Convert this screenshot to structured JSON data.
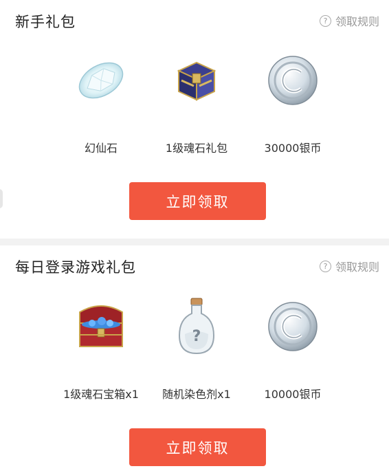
{
  "sections": [
    {
      "title": "新手礼包",
      "rules_label": "领取规则",
      "items": [
        {
          "label": "幻仙石",
          "icon": "crystal-stone-icon"
        },
        {
          "label": "1级魂石礼包",
          "icon": "soul-stone-pack-icon"
        },
        {
          "label": "30000银币",
          "icon": "silver-coin-icon"
        }
      ],
      "claim_label": "立即领取"
    },
    {
      "title": "每日登录游戏礼包",
      "rules_label": "领取规则",
      "items": [
        {
          "label": "1级魂石宝箱x1",
          "icon": "treasure-chest-icon"
        },
        {
          "label": "随机染色剂x1",
          "icon": "potion-bottle-icon"
        },
        {
          "label": "10000银币",
          "icon": "silver-coin-icon"
        }
      ],
      "claim_label": "立即领取"
    }
  ],
  "colors": {
    "accent": "#f2573f",
    "muted": "#999999",
    "divider": "#f2f2f2"
  }
}
